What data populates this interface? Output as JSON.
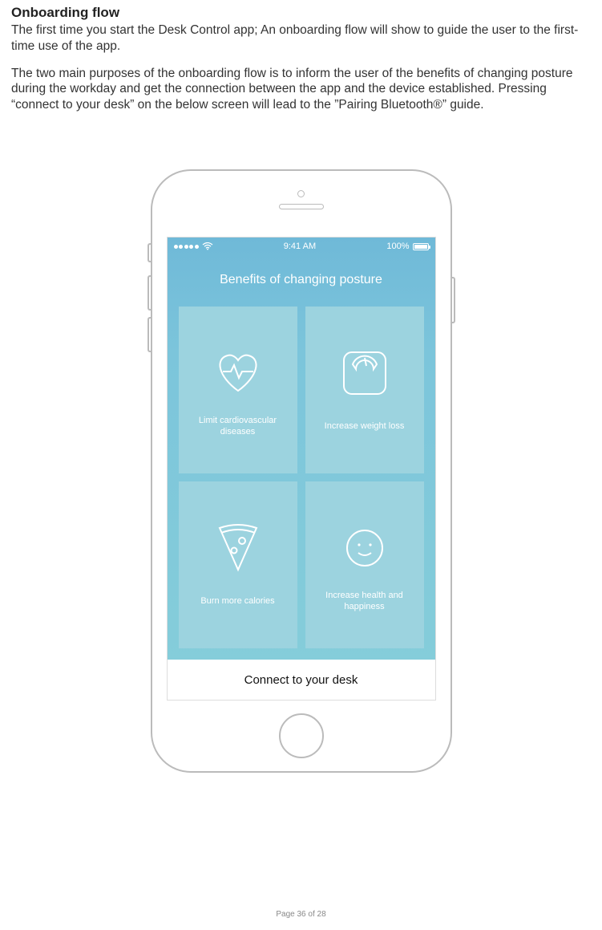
{
  "doc": {
    "heading": "Onboarding flow",
    "para1": "The first time you start the Desk Control app; An onboarding flow will show to guide the user to the first-time use of the app.",
    "para2": "The two main purposes of the onboarding flow is to inform the user of the benefits of changing posture during the workday and get the connection between the app and the device established. Pressing “connect to your desk” on the below screen will lead to the ”Pairing Bluetooth®” guide.",
    "footer": "Page 36 of 28"
  },
  "phone": {
    "status": {
      "time": "9:41 AM",
      "battery_pct": "100%"
    },
    "screen_title": "Benefits of changing posture",
    "tiles": [
      {
        "label": "Limit cardiovascular diseases",
        "icon": "heart-pulse-icon"
      },
      {
        "label": "Increase weight loss",
        "icon": "scale-icon"
      },
      {
        "label": "Burn more calories",
        "icon": "pizza-icon"
      },
      {
        "label": "Increase health and happiness",
        "icon": "smiley-icon"
      }
    ],
    "cta": "Connect to your desk"
  }
}
